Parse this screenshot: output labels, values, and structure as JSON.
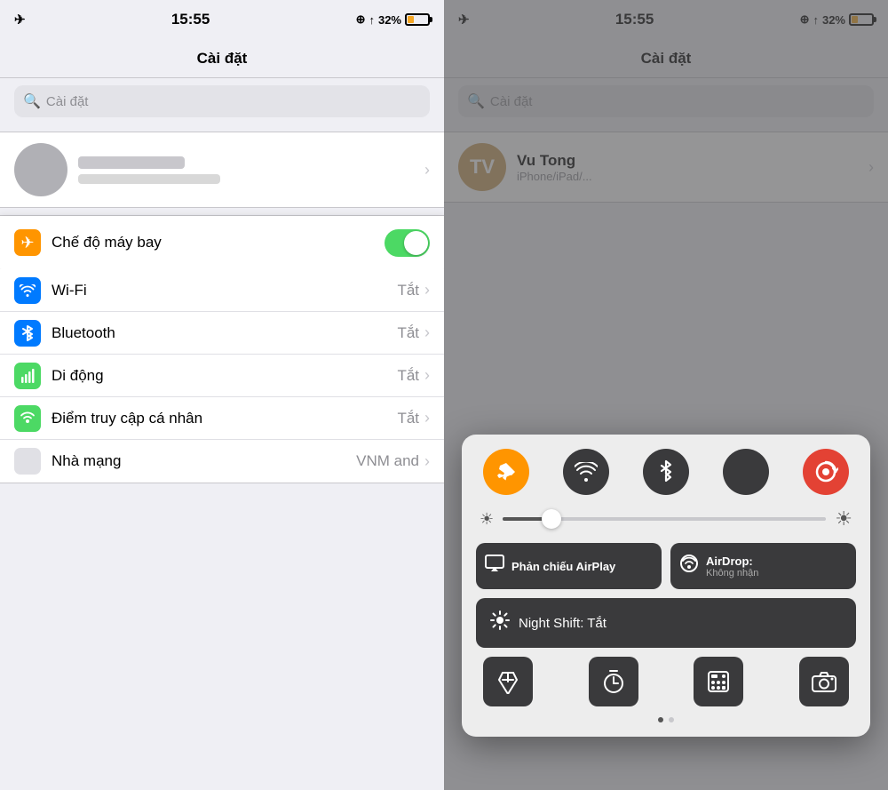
{
  "left": {
    "statusBar": {
      "time": "15:55",
      "signal": "✈",
      "locationIcon": "⊕",
      "arrow": "↑",
      "batteryPercent": "32%"
    },
    "navTitle": "Cài đặt",
    "searchPlaceholder": "Cài đặt",
    "rows": [
      {
        "id": "airplane",
        "label": "Chế độ máy bay",
        "iconColor": "orange",
        "iconSymbol": "✈",
        "hasToggle": true,
        "toggleOn": true,
        "value": "",
        "highlighted": true
      },
      {
        "id": "wifi",
        "label": "Wi-Fi",
        "iconColor": "blue",
        "iconSymbol": "wifi",
        "hasToggle": false,
        "value": "Tắt"
      },
      {
        "id": "bluetooth",
        "label": "Bluetooth",
        "iconColor": "blue",
        "iconSymbol": "bt",
        "hasToggle": false,
        "value": "Tắt"
      },
      {
        "id": "cellular",
        "label": "Di động",
        "iconColor": "green",
        "iconSymbol": "cellular",
        "hasToggle": false,
        "value": "Tắt"
      },
      {
        "id": "hotspot",
        "label": "Điểm truy cập cá nhân",
        "iconColor": "green",
        "iconSymbol": "hotspot",
        "hasToggle": false,
        "value": "Tắt"
      },
      {
        "id": "carrier",
        "label": "Nhà mạng",
        "iconColor": "none",
        "iconSymbol": "",
        "hasToggle": false,
        "value": "VNM and"
      }
    ]
  },
  "right": {
    "statusBar": {
      "time": "15:55",
      "batteryPercent": "32%"
    },
    "navTitle": "Cài đặt",
    "searchPlaceholder": "Cài đặt",
    "profileName": "Vu Tong",
    "controlCenter": {
      "airplaneActive": true,
      "nightShiftLabel": "Night Shift: Tắt",
      "airplayLabel": "Phản chiếu AirPlay",
      "airdropLabel": "AirDrop:",
      "airdropSub": "Không nhận",
      "bottomIcons": [
        "🔦",
        "⏱",
        "⌨️",
        "📷"
      ]
    }
  }
}
